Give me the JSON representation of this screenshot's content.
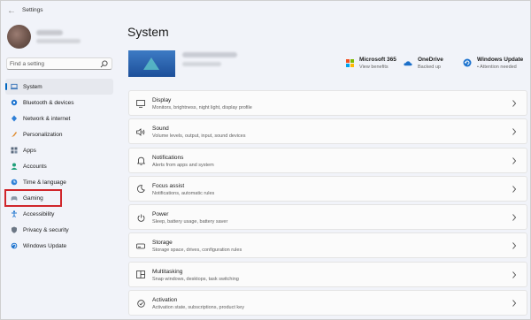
{
  "window": {
    "title": "Settings",
    "back_glyph": "←"
  },
  "search": {
    "placeholder": "Find a setting"
  },
  "sidebar": {
    "items": [
      {
        "label": "System",
        "icon": "laptop-icon",
        "selected": true
      },
      {
        "label": "Bluetooth & devices",
        "icon": "bluetooth-icon"
      },
      {
        "label": "Network & internet",
        "icon": "network-icon"
      },
      {
        "label": "Personalization",
        "icon": "brush-icon"
      },
      {
        "label": "Apps",
        "icon": "apps-icon"
      },
      {
        "label": "Accounts",
        "icon": "accounts-icon"
      },
      {
        "label": "Time & language",
        "icon": "globe-clock-icon"
      },
      {
        "label": "Gaming",
        "icon": "gamepad-icon",
        "highlighted": true
      },
      {
        "label": "Accessibility",
        "icon": "accessibility-icon"
      },
      {
        "label": "Privacy & security",
        "icon": "shield-icon"
      },
      {
        "label": "Windows Update",
        "icon": "update-icon"
      }
    ]
  },
  "main": {
    "title": "System",
    "status": [
      {
        "title": "Microsoft 365",
        "subtitle": "View benefits",
        "icon": "microsoft365-icon"
      },
      {
        "title": "OneDrive",
        "subtitle": "Backed up",
        "icon": "onedrive-icon"
      },
      {
        "title": "Windows Update",
        "subtitle": "• Attention needed",
        "icon": "windows-update-icon"
      }
    ],
    "cards": [
      {
        "title": "Display",
        "desc": "Monitors, brightness, night light, display profile",
        "icon": "display-icon"
      },
      {
        "title": "Sound",
        "desc": "Volume levels, output, input, sound devices",
        "icon": "sound-icon"
      },
      {
        "title": "Notifications",
        "desc": "Alerts from apps and system",
        "icon": "bell-icon"
      },
      {
        "title": "Focus assist",
        "desc": "Notifications, automatic rules",
        "icon": "moon-icon"
      },
      {
        "title": "Power",
        "desc": "Sleep, battery usage, battery saver",
        "icon": "power-icon"
      },
      {
        "title": "Storage",
        "desc": "Storage space, drives, configuration rules",
        "icon": "storage-icon"
      },
      {
        "title": "Multitasking",
        "desc": "Snap windows, desktops, task switching",
        "icon": "multitasking-icon"
      },
      {
        "title": "Activation",
        "desc": "Activation state, subscriptions, product key",
        "icon": "activation-icon"
      }
    ]
  },
  "colors": {
    "accent": "#0067c0",
    "highlight_box": "#d0262b"
  }
}
